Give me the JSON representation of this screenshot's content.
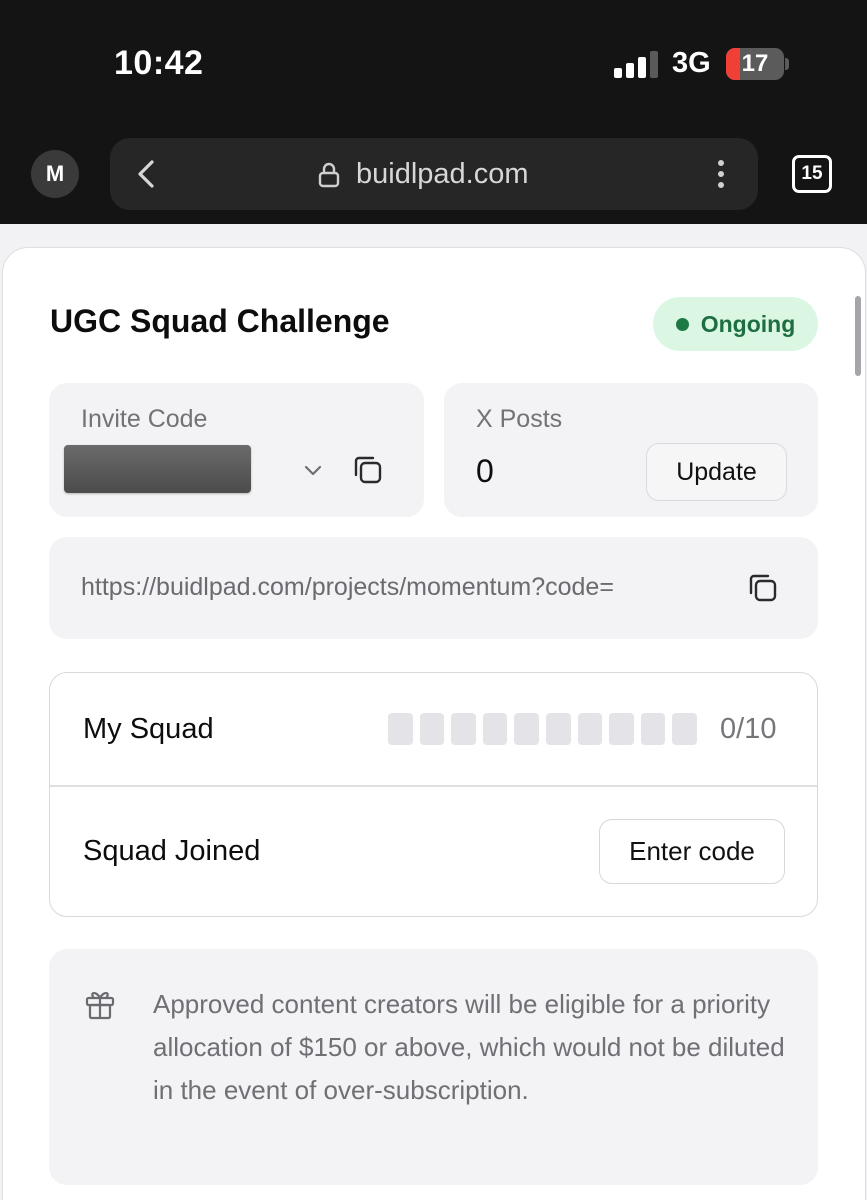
{
  "status_bar": {
    "time": "10:42",
    "network": "3G",
    "battery_level": "17"
  },
  "browser": {
    "profile_initial": "M",
    "url": "buidlpad.com",
    "tab_count": "15"
  },
  "challenge": {
    "title": "UGC Squad Challenge",
    "status": "Ongoing",
    "status_color": "#1d7a45",
    "invite_label": "Invite Code",
    "x_posts_label": "X Posts",
    "x_posts_count": "0",
    "update_label": "Update",
    "invite_link": "https://buidlpad.com/projects/momentum?code="
  },
  "squad": {
    "my_squad_label": "My Squad",
    "members_filled": 0,
    "members_max": 10,
    "count_text": "0/10",
    "joined_label": "Squad Joined",
    "enter_code_label": "Enter code"
  },
  "info": {
    "icon": "gift-icon",
    "text": "Approved content creators will be eligible for a priority allocation of $150 or above, which would not be diluted in the event of over-subscription."
  }
}
